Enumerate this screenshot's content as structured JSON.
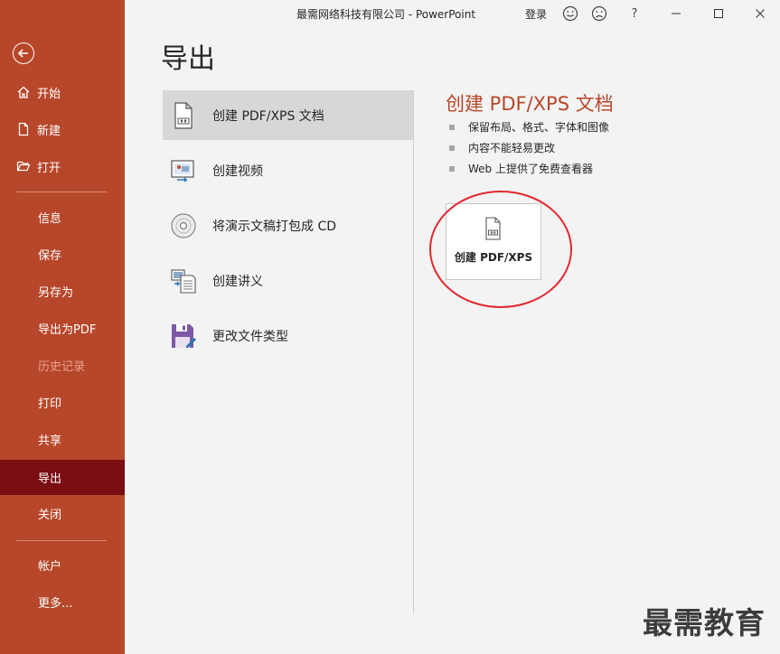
{
  "window": {
    "title": "最需网络科技有限公司  -  PowerPoint",
    "signin": "登录",
    "icons": [
      "smiley-icon",
      "frown-icon",
      "help-icon",
      "minimize-icon",
      "maximize-icon",
      "close-icon"
    ],
    "help_glyph": "?"
  },
  "sidebar": {
    "color": "#b7472a",
    "active_color": "#7a0e12",
    "items": [
      {
        "label": "开始",
        "icon": "home-icon"
      },
      {
        "label": "新建",
        "icon": "new-doc-icon"
      },
      {
        "label": "打开",
        "icon": "folder-open-icon"
      },
      {
        "label": "信息"
      },
      {
        "label": "保存"
      },
      {
        "label": "另存为"
      },
      {
        "label": "导出为PDF"
      },
      {
        "label": "历史记录",
        "disabled": true
      },
      {
        "label": "打印"
      },
      {
        "label": "共享"
      },
      {
        "label": "导出",
        "active": true
      },
      {
        "label": "关闭"
      },
      {
        "label": "帐户"
      },
      {
        "label": "更多..."
      }
    ]
  },
  "main": {
    "title": "导出",
    "options": [
      {
        "label": "创建 PDF/XPS 文档",
        "icon": "pdf-doc-icon",
        "selected": true
      },
      {
        "label": "创建视频",
        "icon": "video-icon"
      },
      {
        "label": "将演示文稿打包成 CD",
        "icon": "cd-icon"
      },
      {
        "label": "创建讲义",
        "icon": "handout-icon"
      },
      {
        "label": "更改文件类型",
        "icon": "file-type-icon"
      }
    ]
  },
  "detail": {
    "title": "创建 PDF/XPS 文档",
    "bullets": [
      "保留布局、格式、字体和图像",
      "内容不能轻易更改",
      "Web 上提供了免费查看器"
    ],
    "button_label": "创建 PDF/XPS"
  },
  "watermark": "最需教育"
}
